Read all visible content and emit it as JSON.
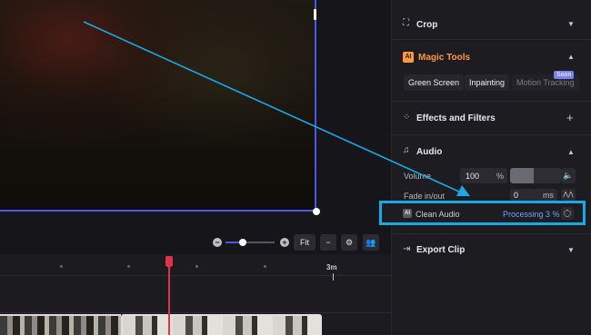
{
  "panel": {
    "crop_title": "Crop",
    "magic_title": "Magic Tools",
    "magic_badge": "AI",
    "tools": [
      "Green Screen",
      "Inpainting",
      "Motion Tracking"
    ],
    "soon_badge": "Soon",
    "effects_title": "Effects and Filters",
    "audio_title": "Audio",
    "volume_label": "Volume",
    "volume_value": "100",
    "volume_unit": "%",
    "fade_label": "Fade in/out",
    "fade_value": "0",
    "fade_unit": "ms",
    "clean_audio_label": "Clean Audio",
    "clean_audio_badge": "AI",
    "processing_text": "Processing 3 %",
    "export_title": "Export Clip"
  },
  "toolbar": {
    "fit_label": "Fit",
    "zoom_level": 0.35
  },
  "timeline": {
    "marker_label": "3m"
  },
  "colors": {
    "accent": "#4b57e6",
    "highlight": "#19a9e6",
    "playhead": "#e0334a",
    "magic": "#ff9a3c"
  }
}
